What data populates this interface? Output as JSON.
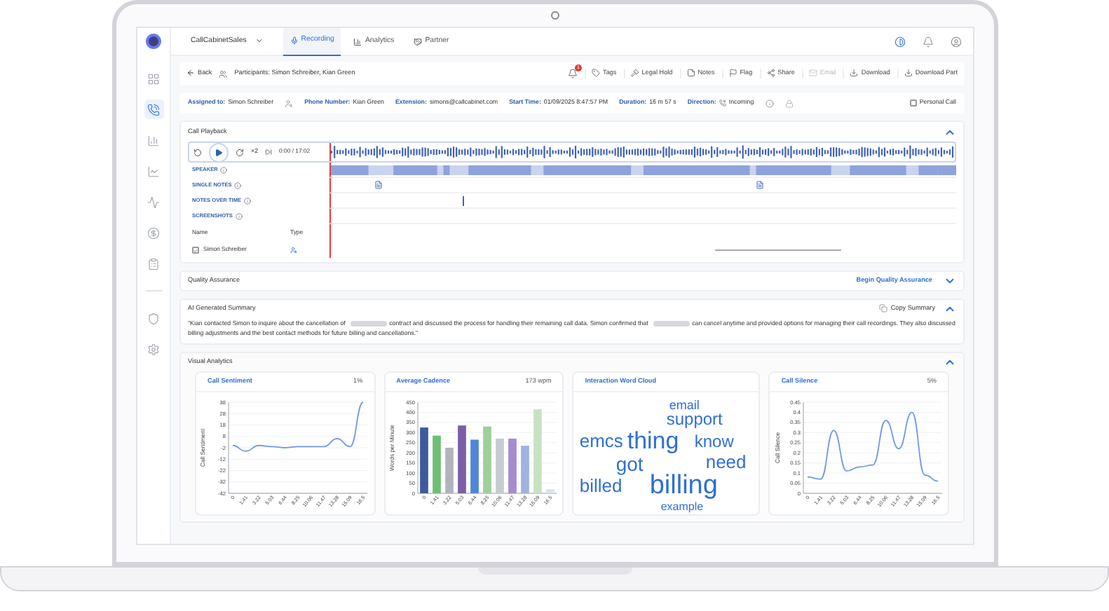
{
  "app": {
    "workspace": "CallCabinetSales",
    "tabs": [
      {
        "label": "Recording",
        "selected": true
      },
      {
        "label": "Analytics",
        "selected": false
      },
      {
        "label": "Partner",
        "selected": false
      }
    ]
  },
  "sidebar": {
    "items": [
      {
        "selected": false
      },
      {
        "selected": true
      },
      {
        "selected": false
      },
      {
        "selected": false
      },
      {
        "selected": false
      },
      {
        "selected": false
      },
      {
        "selected": false
      },
      {
        "selected": false
      },
      {
        "selected": false
      }
    ]
  },
  "toolbar": {
    "back": "Back",
    "participants": "Participants: Simon Schreiber, Kian Green",
    "notification_count": "1",
    "actions": [
      {
        "label": "Tags",
        "disabled": false
      },
      {
        "label": "Legal Hold",
        "disabled": false
      },
      {
        "label": "Notes",
        "disabled": false
      },
      {
        "label": "Flag",
        "disabled": false
      },
      {
        "label": "Share",
        "disabled": false
      },
      {
        "label": "Email",
        "disabled": true
      },
      {
        "label": "Download",
        "disabled": false
      },
      {
        "label": "Download Part",
        "disabled": false
      }
    ]
  },
  "details": {
    "fields": [
      {
        "label": "Assigned to:",
        "value": "Simon Schreiber"
      },
      {
        "label": "Phone Number:",
        "value": "Kian Green"
      },
      {
        "label": "Extension:",
        "value": "simons@callcabinet.com"
      },
      {
        "label": "Start Time:",
        "value": "01/09/2025 8:47:57 PM"
      },
      {
        "label": "Duration:",
        "value": "16 m 57 s"
      },
      {
        "label": "Direction:",
        "value": "Incoming"
      }
    ],
    "personal_call": {
      "label": "Personal Call",
      "checked": false
    }
  },
  "call_playback": {
    "title": "Call Playback",
    "expanded": true,
    "speed": "×2",
    "time": "0:00 / 17:02",
    "tracks": [
      "SPEAKER",
      "SINGLE NOTES",
      "NOTES OVER TIME",
      "SCREENSHOTS"
    ],
    "columns": [
      "Name",
      "Type"
    ],
    "speakers": [
      {
        "name": "Simon Schreiber",
        "checked": true
      }
    ]
  },
  "quality_assurance": {
    "title": "Quality Assurance",
    "action": "Begin Quality Assurance",
    "expanded": false
  },
  "ai_summary": {
    "title": "AI Generated Summary",
    "action": "Copy Summary",
    "expanded": true,
    "parts": [
      "\"Kian contacted Simon to inquire about the cancellation of ",
      "contract and discussed the process for handling their remaining call data. Simon confirmed that ",
      "can cancel anytime and provided options for managing their call recordings. They also discussed billing adjustments and the best contact methods for future billing and cancellations.\""
    ]
  },
  "visual_analytics": {
    "title": "Visual Analytics",
    "expanded": true,
    "cards": [
      {
        "kind": "chart",
        "title": "Call Sentiment",
        "value": "1%",
        "chart_data": {
          "type": "line",
          "ylabel": "Call Sentiment",
          "categories": [
            "0",
            "1.41",
            "3.22",
            "5.03",
            "6.44",
            "8.25",
            "10.06",
            "11.47",
            "13.28",
            "15.09",
            "16.5"
          ],
          "values": [
            0,
            -5,
            0,
            -1,
            -2,
            -1,
            -1,
            -1,
            6,
            -1,
            38
          ],
          "yticks": [
            -42,
            -32,
            -22,
            -12,
            -2,
            8,
            18,
            28,
            38
          ],
          "ylim": [
            -42,
            38
          ],
          "grid": true
        }
      },
      {
        "kind": "chart",
        "title": "Average Cadence",
        "value": "173 wpm",
        "bars": [
          {
            "color": "#3d5a9e"
          },
          {
            "color": "#6fbf73"
          },
          {
            "color": "#b0b4bb"
          },
          {
            "color": "#7b5ea7"
          },
          {
            "color": "#4f86d9"
          },
          {
            "color": "#9fcf9a"
          },
          {
            "color": "#c8cbd1"
          },
          {
            "color": "#a58bd0"
          },
          {
            "color": "#9fb3dd"
          },
          {
            "color": "#c7e2c3"
          },
          {
            "color": "#dde3ea"
          }
        ],
        "chart_data": {
          "type": "bar",
          "ylabel": "Words per Minute",
          "categories": [
            "0",
            "1.41",
            "3.22",
            "5.03",
            "6.44",
            "8.25",
            "10.06",
            "11.47",
            "13.28",
            "15.09",
            "16.5"
          ],
          "values": [
            325,
            285,
            225,
            335,
            265,
            330,
            270,
            270,
            235,
            415,
            20
          ],
          "yticks": [
            0,
            50,
            100,
            150,
            200,
            250,
            300,
            350,
            400,
            450
          ],
          "ylim": [
            0,
            450
          ],
          "grid": true
        }
      },
      {
        "kind": "cloud",
        "title": "Interaction Word Cloud",
        "words": [
          "email",
          "support",
          "emcs",
          "thing",
          "know",
          "got",
          "need",
          "billed",
          "billing",
          "example"
        ]
      },
      {
        "kind": "chart",
        "title": "Call Silence",
        "value": "5%",
        "chart_data": {
          "type": "line",
          "ylabel": "Call Silence",
          "categories": [
            "0",
            "1.41",
            "3.22",
            "5.03",
            "6.44",
            "8.25",
            "10.06",
            "11.47",
            "13.28",
            "15.09",
            "16.5"
          ],
          "values": [
            0.08,
            0.07,
            0.31,
            0.11,
            0.13,
            0.14,
            0.36,
            0.22,
            0.4,
            0.09,
            0.06
          ],
          "yticks": [
            0,
            0.05,
            0.1,
            0.15,
            0.2,
            0.25,
            0.3,
            0.35,
            0.4,
            0.45
          ],
          "ylim": [
            0,
            0.45
          ],
          "grid": true
        }
      }
    ]
  }
}
